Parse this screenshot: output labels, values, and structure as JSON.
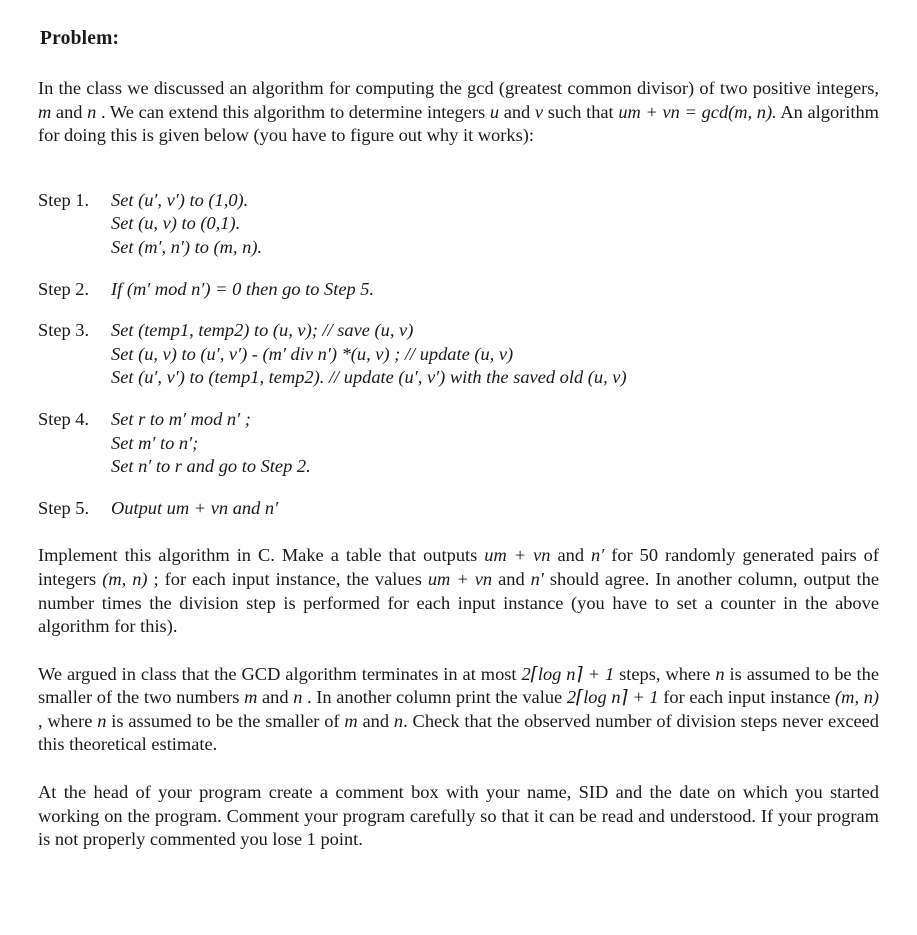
{
  "document": {
    "title": "Problem:",
    "intro": {
      "t1": "In the class we discussed an algorithm for computing the gcd (greatest common divisor) of two positive integers, ",
      "m1": "m",
      "t2": " and ",
      "n1": "n",
      "t3": " . We can extend this algorithm to determine integers ",
      "u1": "u",
      "t4": " and ",
      "v1": "v",
      "t5": " such that ",
      "eq": "um + vn = gcd(m, n).",
      "t6": " An algorithm for doing this is given below (you have to figure out why it works):"
    },
    "steps": [
      {
        "label": "Step 1.",
        "lines": [
          "Set (u′, v′) to (1,0).",
          "Set (u, v) to (0,1).",
          "Set (m′, n′) to (m, n)."
        ]
      },
      {
        "label": "Step 2.",
        "lines": [
          "If (m′ mod n′) = 0 then go to Step 5."
        ]
      },
      {
        "label": "Step 3.",
        "lines": [
          "Set (temp1, temp2) to (u, v); // save (u, v)",
          "Set (u, v) to (u′, v′) - (m′ div n′) *(u, v) ; // update (u, v)",
          "Set (u′, v′) to (temp1, temp2). // update (u′, v′) with the saved old (u, v)"
        ]
      },
      {
        "label": "Step 4.",
        "lines": [
          "Set r to m′ mod n′ ;",
          "Set m′ to n′;",
          "Set n′ to r and go to Step 2."
        ]
      },
      {
        "label": "Step 5.",
        "lines": [
          "Output um + vn and n′"
        ]
      }
    ],
    "paragraphs": {
      "implement": {
        "p1": "Implement this algorithm in C. Make a table that outputs ",
        "e1": "um + vn",
        "p2": " and ",
        "e2": "n′",
        "p3": " for 50 randomly generated pairs of integers ",
        "e3": "(m, n)",
        "p4": " ; for each input instance, the values ",
        "e4": "um + vn",
        "p5": " and ",
        "e5": "n′",
        "p6": " should agree. In another column, output the number times the division step is performed for each input instance (you have to set a counter in the above algorithm for this)."
      },
      "argued": {
        "p1": "We argued in class that the GCD algorithm terminates in at most ",
        "e1": "2⌈log n⌉ + 1",
        "p2": " steps, where ",
        "e2": "n",
        "p3": " is assumed to be the smaller of the two numbers ",
        "e3": "m",
        "p4": " and ",
        "e4": "n",
        "p5": " . In another column print the value ",
        "e5": "2⌈log n⌉ + 1",
        "p6": " for each input instance ",
        "e6": "(m, n)",
        "p7": " , where ",
        "e7": "n",
        "p8": " is assumed to be the smaller of ",
        "e8": "m",
        "p9": " and ",
        "e9": "n",
        "p10": ". Check that the observed number of division steps never exceed this theoretical estimate."
      },
      "comment_box": "At the head of your program create a comment box with your name, SID and the date on which you started working on the program. Comment your program carefully so that it can be read and understood. If your program is not properly commented you lose 1 point."
    }
  }
}
